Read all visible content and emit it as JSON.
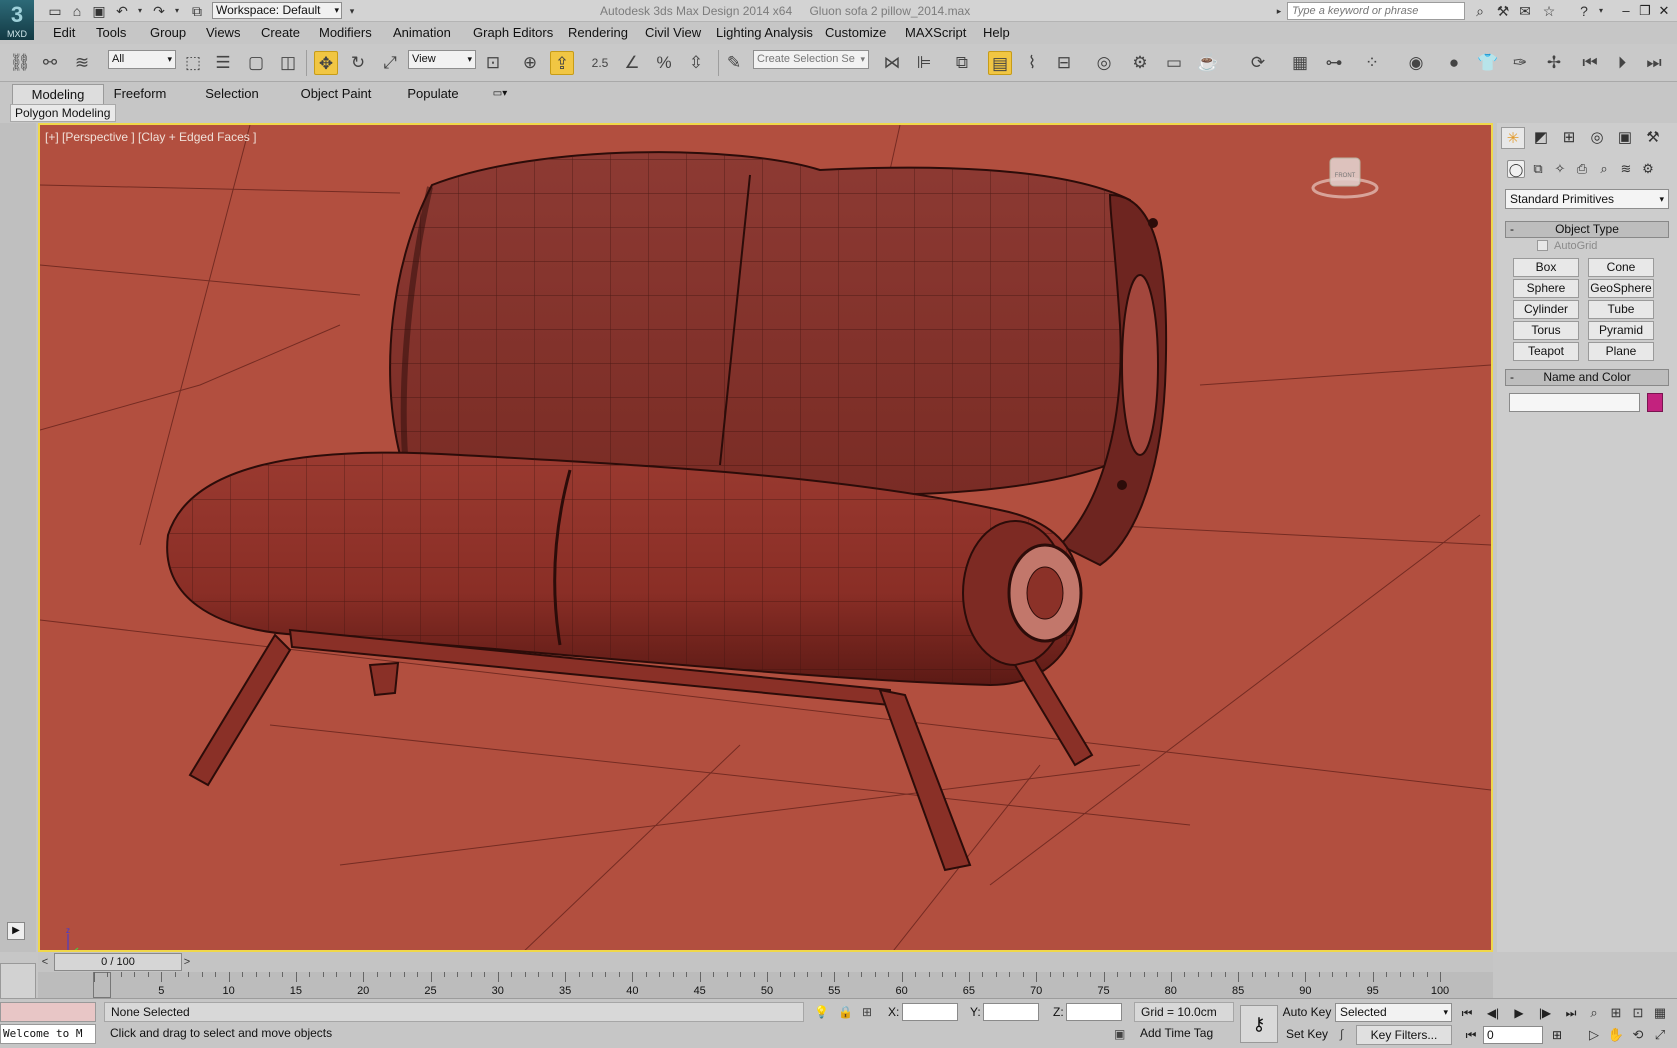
{
  "title_bar": {
    "logo_text": "MXD",
    "workspace_label": "Workspace: Default",
    "app_name": "Autodesk 3ds Max Design 2014 x64",
    "file_name": "Gluon sofa 2 pillow_2014.max",
    "search_placeholder": "Type a keyword or phrase"
  },
  "menu": [
    "Edit",
    "Tools",
    "Group",
    "Views",
    "Create",
    "Modifiers",
    "Animation",
    "Graph Editors",
    "Rendering",
    "Civil View",
    "Lighting Analysis",
    "Customize",
    "MAXScript",
    "Help"
  ],
  "toolbar": {
    "selection_filter": "All",
    "reference_coord": "View",
    "snap_value": "2.5",
    "named_selection_placeholder": "Create Selection Se"
  },
  "ribbon": {
    "tabs": [
      "Modeling",
      "Freeform",
      "Selection",
      "Object Paint",
      "Populate"
    ],
    "active_tab": "Modeling",
    "panel_label": "Polygon Modeling"
  },
  "viewport": {
    "label": "[+] [Perspective ] [Clay + Edged Faces ]",
    "background_color": "#b24f3f",
    "viewcube_face": "FRONT"
  },
  "command_panel": {
    "category_dropdown": "Standard Primitives",
    "object_type_title": "Object Type",
    "autogrid_label": "AutoGrid",
    "primitives": [
      "Box",
      "Cone",
      "Sphere",
      "GeoSphere",
      "Cylinder",
      "Tube",
      "Torus",
      "Pyramid",
      "Teapot",
      "Plane"
    ],
    "name_color_title": "Name and Color",
    "object_color": "#c3227e"
  },
  "timeline": {
    "frame_display": "0 / 100",
    "ticks": [
      0,
      5,
      10,
      15,
      20,
      25,
      30,
      35,
      40,
      45,
      50,
      55,
      60,
      65,
      70,
      75,
      80,
      85,
      90,
      95,
      100
    ]
  },
  "status": {
    "listener_text": "Welcome to M",
    "selection_status": "None Selected",
    "prompt": "Click and drag to select and move objects",
    "x_label": "X:",
    "y_label": "Y:",
    "z_label": "Z:",
    "grid": "Grid = 10.0cm",
    "add_time_tag": "Add Time Tag",
    "auto_key": "Auto Key",
    "set_key": "Set Key",
    "key_mode": "Selected",
    "key_filters": "Key Filters...",
    "current_frame": "0"
  }
}
